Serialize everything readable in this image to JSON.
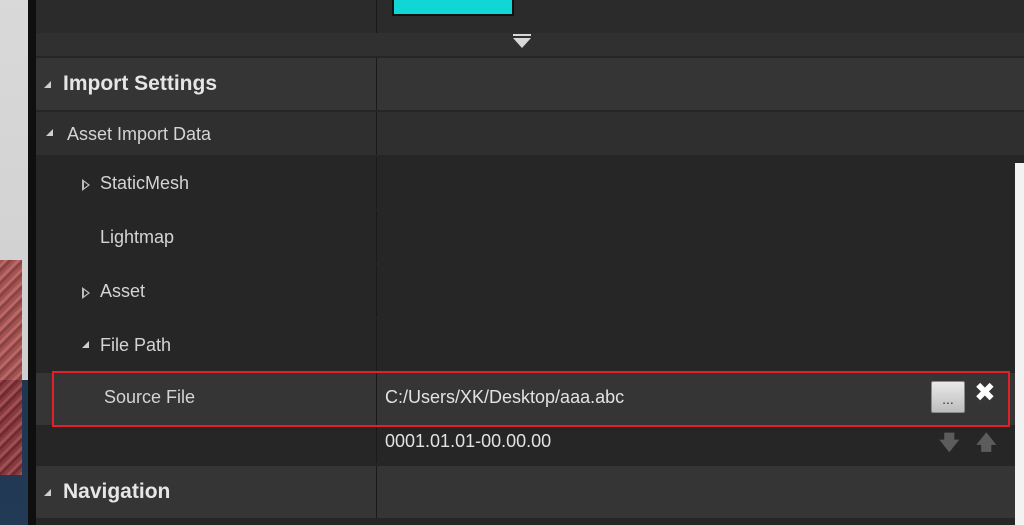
{
  "sections": {
    "import_settings": {
      "label": "Import Settings"
    },
    "asset_import_data": {
      "label": "Asset Import Data"
    },
    "navigation": {
      "label": "Navigation"
    }
  },
  "properties": {
    "static_mesh": {
      "label": "StaticMesh"
    },
    "lightmap": {
      "label": "Lightmap"
    },
    "asset": {
      "label": "Asset"
    },
    "file_path": {
      "label": "File Path"
    },
    "source_file": {
      "label": "Source File",
      "value": "C:/Users/XK/Desktop/aaa.abc",
      "timestamp": "0001.01.01-00.00.00",
      "browse_label": "...",
      "clear_label": "✖"
    }
  },
  "icons": {
    "expand": "expand-arrow-icon",
    "move_down": "arrow-down-icon",
    "move_up": "arrow-up-icon"
  },
  "colors": {
    "swatch": "#10d7d6",
    "highlight": "#e0202a"
  }
}
